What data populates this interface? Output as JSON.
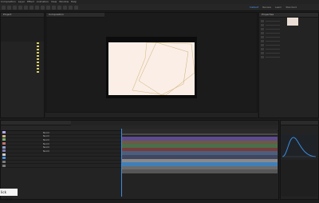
{
  "menubar": {
    "items": [
      "Composition",
      "Layer",
      "Effect",
      "Animation",
      "View",
      "Window",
      "Help"
    ]
  },
  "workspaces": {
    "tabs": [
      "Default",
      "Review",
      "Learn",
      "Standard"
    ],
    "active_index": 0
  },
  "project": {
    "tab_label": "Project",
    "items": [
      {
        "name": "",
        "color": "#e0d56a"
      },
      {
        "name": "",
        "color": "#e0d56a"
      },
      {
        "name": "",
        "color": "#e0d56a"
      },
      {
        "name": "",
        "color": "#e0d56a"
      },
      {
        "name": "",
        "color": "#e0d56a"
      },
      {
        "name": "",
        "color": "#e0d56a"
      },
      {
        "name": "",
        "color": "#e0d56a"
      },
      {
        "name": "",
        "color": "#e0d56a"
      },
      {
        "name": "",
        "color": "#e0d56a"
      },
      {
        "name": "",
        "color": "#e0d56a"
      }
    ]
  },
  "composition": {
    "tab_label": "Composition",
    "canvas_color": "#fbeee6",
    "frame_color": "#0c0c0c"
  },
  "timeline": {
    "tab_label": "",
    "layers": [
      {
        "name": "",
        "mode": "Norm",
        "color": "#b5a3f0"
      },
      {
        "name": "",
        "mode": "Norm",
        "color": "#c8b07a"
      },
      {
        "name": "",
        "mode": "Norm",
        "color": "#7fa877"
      },
      {
        "name": "",
        "mode": "Norm",
        "color": "#c46f6f"
      },
      {
        "name": "",
        "mode": "Norm",
        "color": "#8aa0c4"
      },
      {
        "name": "",
        "mode": "Norm",
        "color": "#7f7fb5"
      },
      {
        "name": "",
        "mode": "",
        "color": "#cfcfcf"
      },
      {
        "name": "",
        "mode": "",
        "color": "#4a90d9"
      },
      {
        "name": "",
        "mode": "",
        "color": "#7a7a7a"
      },
      {
        "name": "",
        "mode": "",
        "color": "#7a7a7a"
      }
    ],
    "track_colors": [
      "#5e4b8f",
      "#6b5a45",
      "#4c6e4a",
      "#7a3b3b",
      "#4a5f7e",
      "#40465f",
      "#8a8a8a",
      "#3f7fb9",
      "#6c6c6c",
      "#565656"
    ]
  },
  "properties": {
    "tab_label": "Properties"
  },
  "graph": {
    "tab_label": "",
    "curve_color": "#3b8de0"
  },
  "tooltip": {
    "text": "lick (+Ctrl)"
  }
}
